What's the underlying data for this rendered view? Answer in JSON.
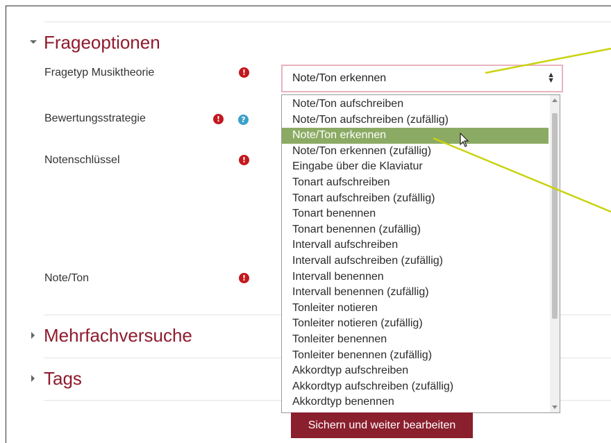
{
  "sections": {
    "frageoptionen": {
      "title": "Frageoptionen"
    },
    "mehrfachversuche": {
      "title": "Mehrfachversuche"
    },
    "tags": {
      "title": "Tags"
    }
  },
  "fields": {
    "fragetyp": {
      "label": "Fragetyp Musiktheorie"
    },
    "bewertung": {
      "label": "Bewertungsstrategie"
    },
    "notenschluessel": {
      "label": "Notenschlüssel"
    },
    "noteton": {
      "label": "Note/Ton"
    }
  },
  "select": {
    "value": "Note/Ton erkennen",
    "options": [
      "Note/Ton aufschreiben",
      "Note/Ton aufschreiben (zufällig)",
      "Note/Ton erkennen",
      "Note/Ton erkennen (zufällig)",
      "Eingabe über die Klaviatur",
      "Tonart aufschreiben",
      "Tonart aufschreiben (zufällig)",
      "Tonart benennen",
      "Tonart benennen (zufällig)",
      "Intervall aufschreiben",
      "Intervall aufschreiben (zufällig)",
      "Intervall benennen",
      "Intervall benennen (zufällig)",
      "Tonleiter notieren",
      "Tonleiter notieren (zufällig)",
      "Tonleiter benennen",
      "Tonleiter benennen (zufällig)",
      "Akkordtyp aufschreiben",
      "Akkordtyp aufschreiben (zufällig)",
      "Akkordtyp benennen"
    ],
    "selected_index": 2
  },
  "buttons": {
    "submit": "Sichern und weiter bearbeiten"
  },
  "icons": {
    "required": "!",
    "help": "?"
  },
  "colors": {
    "section_title": "#8f1b2d",
    "required_icon": "#c2181e",
    "help_icon": "#3aa0c8",
    "highlight": "#8bab64",
    "button_bg": "#8a1f2e",
    "annotation_line": "#c9d30e"
  }
}
